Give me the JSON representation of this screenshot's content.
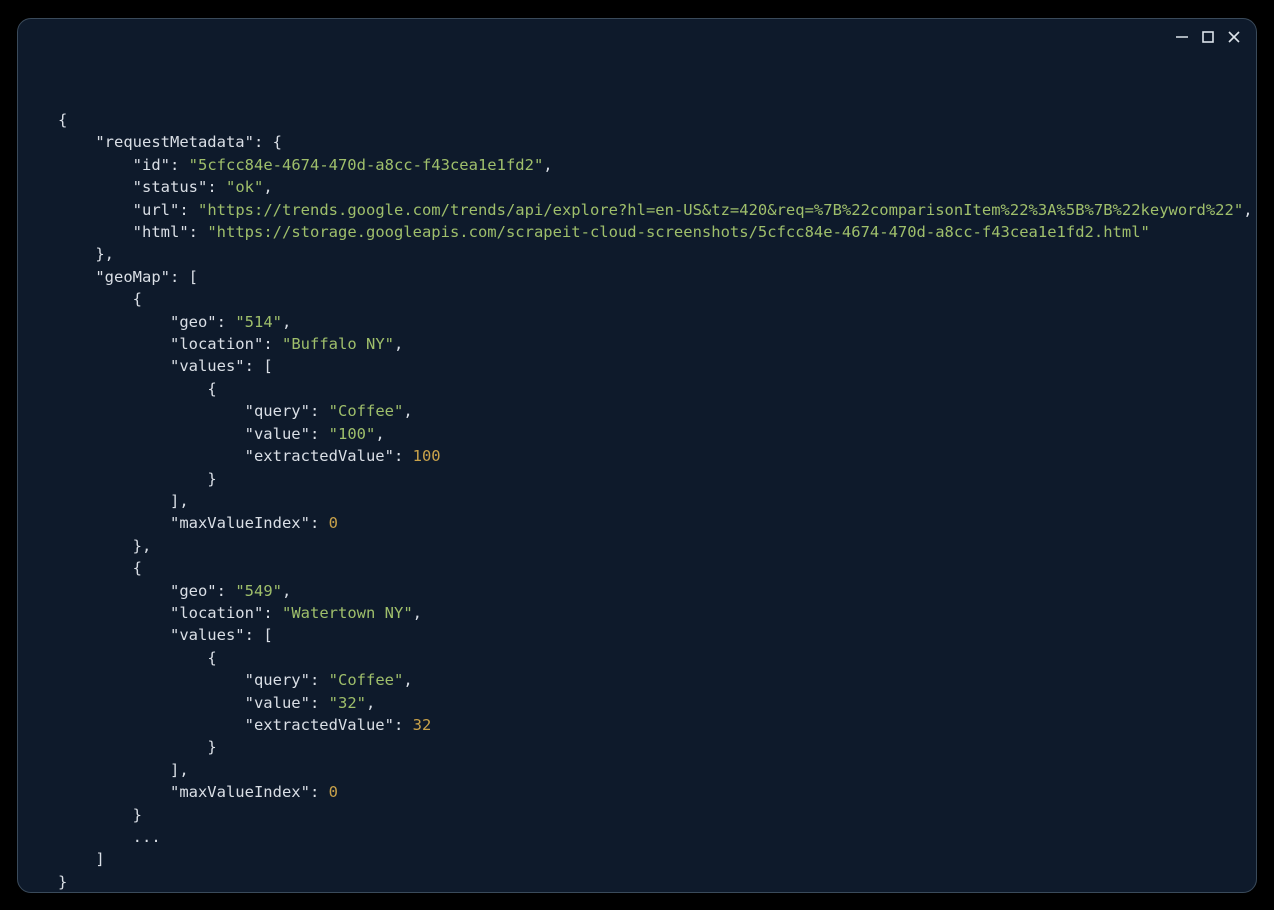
{
  "window": {
    "controls": {
      "minimize": "minimize",
      "maximize": "maximize",
      "close": "close"
    }
  },
  "json": {
    "requestMetadata": {
      "id": "5cfcc84e-4674-470d-a8cc-f43cea1e1fd2",
      "status": "ok",
      "url": "https://trends.google.com/trends/api/explore?hl=en-US&tz=420&req=%7B%22comparisonItem%22%3A%5B%7B%22keyword%22",
      "html": "https://storage.googleapis.com/scrapeit-cloud-screenshots/5cfcc84e-4674-470d-a8cc-f43cea1e1fd2.html"
    },
    "geoMap": [
      {
        "geo": "514",
        "location": "Buffalo NY",
        "values": [
          {
            "query": "Coffee",
            "value": "100",
            "extractedValue": 100
          }
        ],
        "maxValueIndex": 0
      },
      {
        "geo": "549",
        "location": "Watertown NY",
        "values": [
          {
            "query": "Coffee",
            "value": "32",
            "extractedValue": 32
          }
        ],
        "maxValueIndex": 0
      }
    ],
    "ellipsis": "..."
  }
}
